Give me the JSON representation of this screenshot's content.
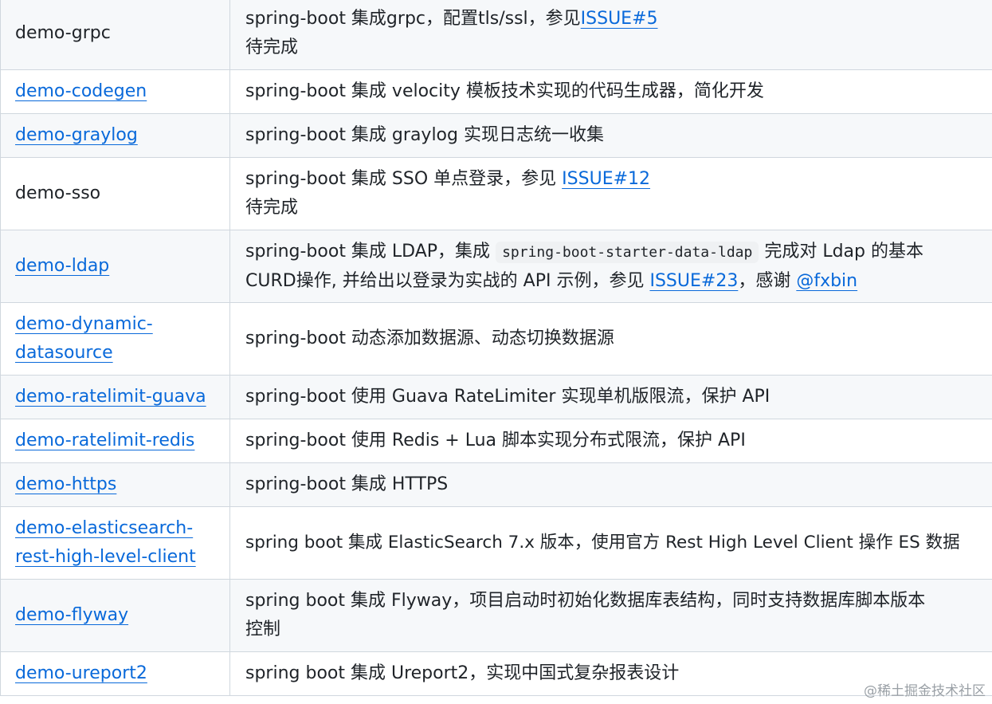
{
  "rows": [
    {
      "name": "demo-grpc",
      "desc": "spring-boot 集成grpc，配置tls/ssl，参见",
      "link": "ISSUE#5",
      "line2": "待完成"
    },
    {
      "name": "demo-codegen",
      "desc": "spring-boot 集成 velocity 模板技术实现的代码生成器，简化开发"
    },
    {
      "name": "demo-graylog",
      "desc": "spring-boot 集成 graylog 实现日志统一收集"
    },
    {
      "name": "demo-sso",
      "desc": "spring-boot 集成 SSO 单点登录，参见 ",
      "link": "ISSUE#12",
      "line2": "待完成"
    },
    {
      "name": "demo-ldap",
      "desc_a": "spring-boot 集成 LDAP，集成 ",
      "code": "spring-boot-starter-data-ldap",
      "desc_b": " 完成对 Ldap 的基本",
      "line2_a": "CURD操作, 并给出以登录为实战的 API 示例，参见 ",
      "link": "ISSUE#23",
      "line2_b": "，感谢 ",
      "link2": "@fxbin"
    },
    {
      "name_a": "demo-dynamic-",
      "name_b": "datasource",
      "desc": "spring-boot 动态添加数据源、动态切换数据源"
    },
    {
      "name": "demo-ratelimit-guava",
      "desc": "spring-boot 使用 Guava RateLimiter 实现单机版限流，保护 API"
    },
    {
      "name": "demo-ratelimit-redis",
      "desc": "spring-boot 使用 Redis + Lua 脚本实现分布式限流，保护 API"
    },
    {
      "name": "demo-https",
      "desc": "spring-boot 集成 HTTPS"
    },
    {
      "name_a": "demo-elasticsearch-",
      "name_b": "rest-high-level-client",
      "desc": "spring boot 集成 ElasticSearch 7.x 版本，使用官方 Rest High Level Client 操作 ES 数据"
    },
    {
      "name": "demo-flyway",
      "desc": "spring boot 集成 Flyway，项目启动时初始化数据库表结构，同时支持数据库脚本版本",
      "line2": "控制"
    },
    {
      "name": "demo-ureport2",
      "desc": "spring boot 集成 Ureport2，实现中国式复杂报表设计"
    }
  ],
  "watermark": "@稀土掘金技术社区"
}
